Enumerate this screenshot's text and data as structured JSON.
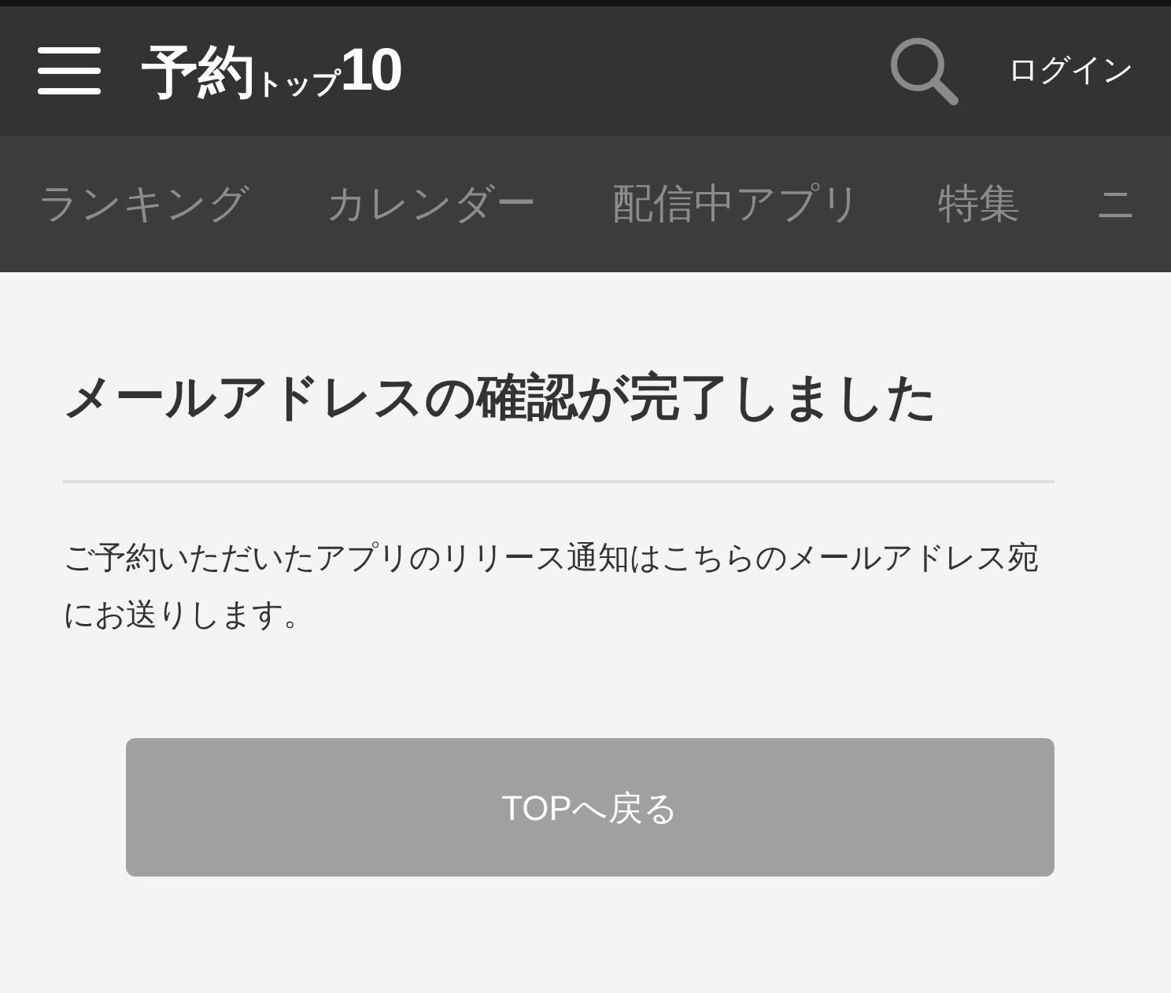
{
  "header": {
    "logo": {
      "main": "予約",
      "sub": "トップ",
      "number": "10"
    },
    "login": "ログイン"
  },
  "nav": [
    {
      "label": "ランキング"
    },
    {
      "label": "カレンダー"
    },
    {
      "label": "配信中アプリ"
    },
    {
      "label": "特集"
    },
    {
      "label": "ニ"
    }
  ],
  "heading": "メールアドレスの確認が完了しました",
  "message": "ご予約いただいたアプリのリリース通知はこちらのメールアドレス宛にお送りします。",
  "button": "TOPへ戻る"
}
